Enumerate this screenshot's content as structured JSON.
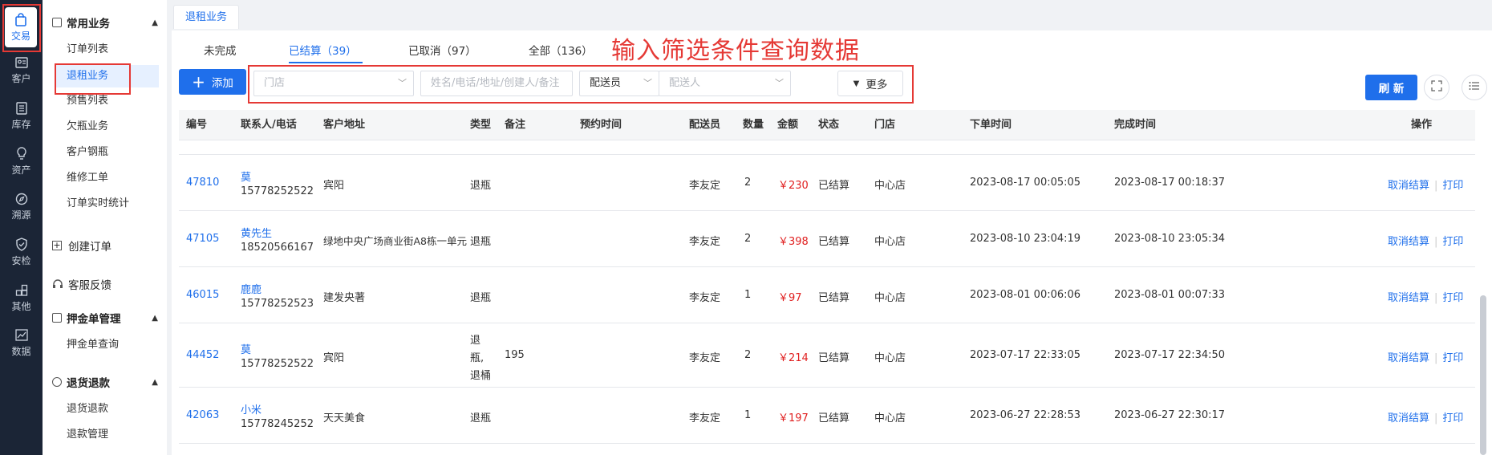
{
  "rail": [
    {
      "label": "交易",
      "icon": "bag-icon"
    },
    {
      "label": "客户",
      "icon": "id-card-icon"
    },
    {
      "label": "库存",
      "icon": "inventory-icon"
    },
    {
      "label": "资产",
      "icon": "bulb-icon"
    },
    {
      "label": "溯源",
      "icon": "compass-icon"
    },
    {
      "label": "安检",
      "icon": "shield-icon"
    },
    {
      "label": "其他",
      "icon": "apps-icon"
    },
    {
      "label": "数据",
      "icon": "chart-icon"
    }
  ],
  "sidebar": {
    "common": {
      "title": "常用业务",
      "items": [
        "订单列表",
        "退租业务",
        "预售列表",
        "欠瓶业务",
        "客户钢瓶",
        "维修工单",
        "订单实时统计"
      ]
    },
    "create_order": "创建订单",
    "feedback": "客服反馈",
    "deposit": {
      "title": "押金单管理",
      "items": [
        "押金单查询"
      ]
    },
    "refund": {
      "title": "退货退款",
      "items": [
        "退货退款",
        "退款管理"
      ]
    }
  },
  "page_tab": "退租业务",
  "status_tabs": [
    "未完成",
    "已结算（39）",
    "已取消（97）",
    "全部（136）"
  ],
  "annotation": "输入筛选条件查询数据",
  "toolbar": {
    "add": "添加",
    "store_placeholder": "门店",
    "search_placeholder": "姓名/电话/地址/创建人/备注",
    "courier_select": "配送员",
    "courier_placeholder": "配送人",
    "more": "更多",
    "refresh": "刷 新"
  },
  "table": {
    "headers": [
      "编号",
      "联系人/电话",
      "客户地址",
      "类型",
      "备注",
      "预约时间",
      "配送员",
      "数量",
      "金额",
      "状态",
      "门店",
      "下单时间",
      "完成时间",
      "操作"
    ],
    "rows": [
      {
        "id": "47810",
        "name": "莫",
        "phone": "15778252522",
        "address": "宾阳",
        "type": "退瓶",
        "note": "",
        "appt": "",
        "courier": "李友定",
        "qty": "2",
        "amount": "￥230",
        "status": "已结算",
        "store": "中心店",
        "ordered": "2023-08-17 00:05:05",
        "finished": "2023-08-17 00:18:37"
      },
      {
        "id": "47105",
        "name": "黄先生",
        "phone": "18520566167",
        "address": "绿地中央广场商业街A8栋一单元",
        "type": "退瓶",
        "note": "",
        "appt": "",
        "courier": "李友定",
        "qty": "2",
        "amount": "￥398",
        "status": "已结算",
        "store": "中心店",
        "ordered": "2023-08-10 23:04:19",
        "finished": "2023-08-10 23:05:34"
      },
      {
        "id": "46015",
        "name": "鹿鹿",
        "phone": "15778252523",
        "address": "建发央著",
        "type": "退瓶",
        "note": "",
        "appt": "",
        "courier": "李友定",
        "qty": "1",
        "amount": "￥97",
        "status": "已结算",
        "store": "中心店",
        "ordered": "2023-08-01 00:06:06",
        "finished": "2023-08-01 00:07:33"
      },
      {
        "id": "44452",
        "name": "莫",
        "phone": "15778252522",
        "address": "宾阳",
        "type_lines": [
          "退",
          "瓶,",
          "退桶"
        ],
        "note": "195",
        "appt": "",
        "courier": "李友定",
        "qty": "2",
        "amount": "￥214",
        "status": "已结算",
        "store": "中心店",
        "ordered": "2023-07-17 22:33:05",
        "finished": "2023-07-17 22:34:50"
      },
      {
        "id": "42063",
        "name": "小米",
        "phone": "15778245252",
        "address": "天天美食",
        "type": "退瓶",
        "note": "",
        "appt": "",
        "courier": "李友定",
        "qty": "1",
        "amount": "￥197",
        "status": "已结算",
        "store": "中心店",
        "ordered": "2023-06-27 22:28:53",
        "finished": "2023-06-27 22:30:17"
      }
    ],
    "ops": {
      "cancel": "取消结算",
      "print": "打印"
    }
  },
  "colors": {
    "accent": "#1f6feb",
    "highlight": "#e53935",
    "amount": "#e02020",
    "rail": "#1b2536"
  }
}
